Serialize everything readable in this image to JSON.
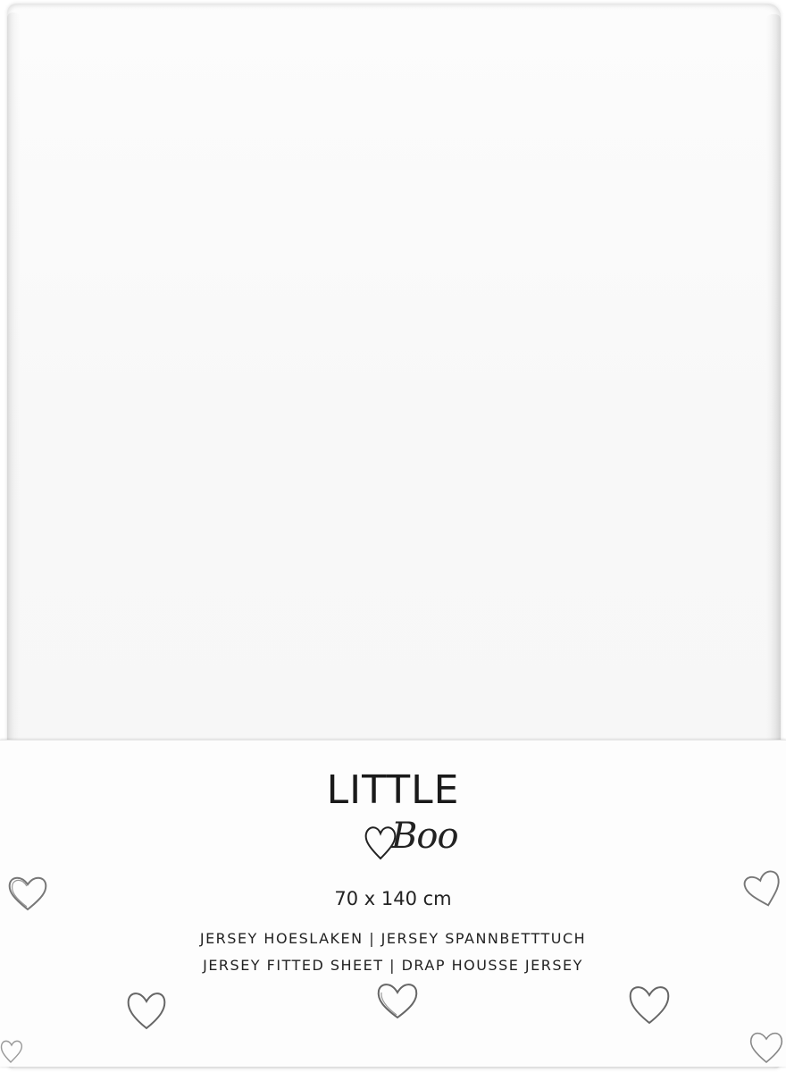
{
  "brand": {
    "name_top": "LITTLE",
    "name_script": "Boo"
  },
  "product": {
    "size": "70 x 140 cm",
    "line_nl_de": "JERSEY HOESLAKEN | JERSEY SPANNBETTTUCH",
    "line_en_fr": "JERSEY FITTED SHEET | DRAP HOUSSE JERSEY"
  },
  "colors": {
    "sheet": "#f8f8f8",
    "band": "#fdfdfd",
    "ink": "#1a1a1a",
    "heart_outline": "#6e6e6e"
  }
}
